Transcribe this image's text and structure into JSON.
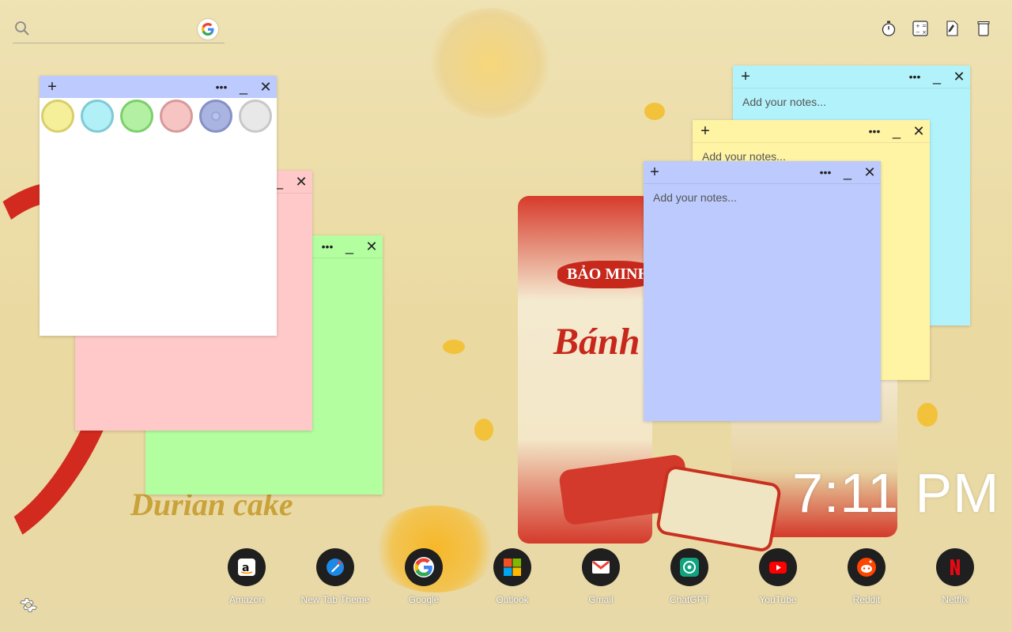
{
  "search": {
    "placeholder": "",
    "value": ""
  },
  "top_toolbar": {
    "icons": [
      "stopwatch-icon",
      "calculator-icon",
      "pen-icon",
      "trash-icon"
    ]
  },
  "color_picker_note": {
    "add": "+",
    "menu": "•••",
    "minimize": "_",
    "close": "✕",
    "swatches": [
      "#f6ef9a",
      "#b1f0f6",
      "#b3f0a3",
      "#f7c4c4",
      "#aab4e0",
      "#e8e8e8"
    ]
  },
  "pink_note": {
    "minimize": "_",
    "close": "✕",
    "color": "#ffc9c9"
  },
  "green_note": {
    "menu": "•••",
    "minimize": "_",
    "close": "✕",
    "color": "#b3ffa0"
  },
  "cyan_note": {
    "add": "+",
    "menu": "•••",
    "minimize": "_",
    "close": "✕",
    "placeholder": "Add your notes...",
    "color": "#b2f3fb"
  },
  "yellow_note": {
    "add": "+",
    "menu": "•••",
    "minimize": "_",
    "close": "✕",
    "placeholder": "Add your notes...",
    "color": "#fff3a4"
  },
  "blue_note": {
    "add": "+",
    "menu": "•••",
    "minimize": "_",
    "close": "✕",
    "placeholder": "Add your notes...",
    "color": "#bccafd"
  },
  "background_art": {
    "brand": "BẢO MINH",
    "product": "Bánh Pía",
    "flavor": "Durian cake"
  },
  "clock": "7:11 PM",
  "dock": [
    {
      "label": "Amazon",
      "icon": "amazon-icon"
    },
    {
      "label": "New Tab Theme",
      "icon": "new-tab-theme-icon"
    },
    {
      "label": "Google",
      "icon": "google-icon"
    },
    {
      "label": "Outlook",
      "icon": "outlook-icon"
    },
    {
      "label": "Gmail",
      "icon": "gmail-icon"
    },
    {
      "label": "ChatGPT",
      "icon": "chatgpt-icon"
    },
    {
      "label": "YouTube",
      "icon": "youtube-icon"
    },
    {
      "label": "Reddit",
      "icon": "reddit-icon"
    },
    {
      "label": "Netflix",
      "icon": "netflix-icon"
    }
  ]
}
